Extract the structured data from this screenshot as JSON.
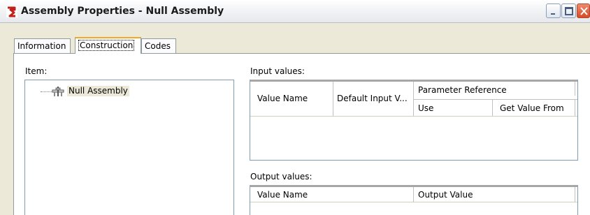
{
  "window": {
    "title": "Assembly Properties - Null Assembly",
    "icon": "app-logo-icon"
  },
  "title_buttons": {
    "minimize": "minimize-icon",
    "maximize": "maximize-icon",
    "close": "close-icon"
  },
  "tabs": [
    {
      "label": "Information",
      "active": false
    },
    {
      "label": "Construction",
      "active": true
    },
    {
      "label": "Codes",
      "active": false
    }
  ],
  "item": {
    "label": "Item:",
    "tree": [
      {
        "label": "Null Assembly",
        "icon": "assembly-icon",
        "selected": true
      }
    ]
  },
  "input_values": {
    "label": "Input values:",
    "columns": {
      "value_name": "Value Name",
      "default_input": "Default Input V...",
      "parameter_reference": "Parameter Reference",
      "use": "Use",
      "get_value_from": "Get Value From"
    },
    "rows": []
  },
  "output_values": {
    "label": "Output values:",
    "columns": {
      "value_name": "Value Name",
      "output_value": "Output Value"
    },
    "rows": []
  }
}
